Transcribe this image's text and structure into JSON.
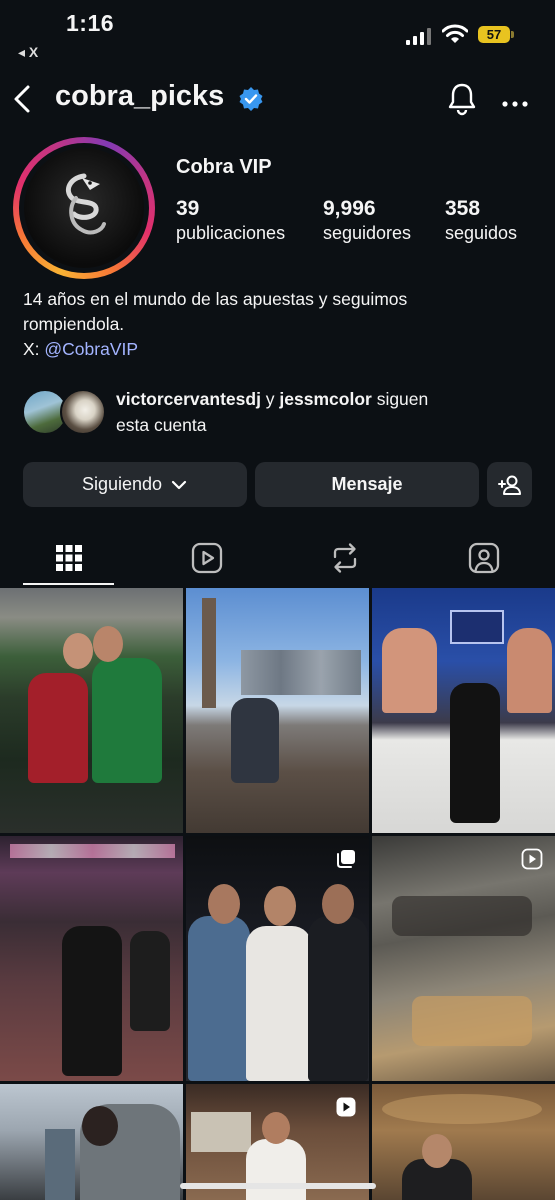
{
  "status_bar": {
    "time": "1:16",
    "back_app": "◂ X",
    "battery": "57"
  },
  "header": {
    "username": "cobra_picks",
    "verified": true,
    "icons": [
      "back-arrow-icon",
      "bell-icon",
      "more-icon"
    ]
  },
  "profile": {
    "display_name": "Cobra VIP",
    "stats": [
      {
        "value": "39",
        "label": "publicaciones"
      },
      {
        "value": "9,996",
        "label": "seguidores"
      },
      {
        "value": "358",
        "label": "seguidos"
      }
    ],
    "bio_line1": "14 años en el mundo de las apuestas y seguimos",
    "bio_line2": "rompiendola.",
    "bio_x_prefix": "X: ",
    "bio_x_handle": "@CobraVIP"
  },
  "mutual": {
    "user1": "victorcervantesdj",
    "conj": " y ",
    "user2": "jessmcolor",
    "suffix_1": " siguen",
    "suffix_2": "esta cuenta"
  },
  "actions": {
    "following_label": "Siguiendo",
    "message_label": "Mensaje"
  },
  "tabs": [
    "grid-icon",
    "reels-icon",
    "reposts-icon",
    "tagged-icon"
  ],
  "colors": {
    "background": "#0c1014",
    "button": "#25292e",
    "link": "#a3b4ff",
    "verified": "#3897f0"
  }
}
